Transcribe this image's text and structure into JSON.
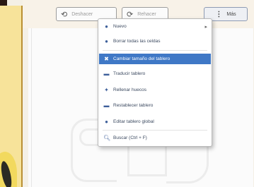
{
  "toolbar": {
    "undo_label": "Deshacer",
    "redo_label": "Rehacer",
    "more_label": "Más"
  },
  "menu": {
    "items": [
      {
        "label": "Nuevo",
        "icon": "plus-circle-icon",
        "has_submenu": true
      },
      {
        "label": "Borrar todas las celdas",
        "icon": "minus-circle-icon"
      },
      {
        "label": "Cambiar tamaño del tablero",
        "icon": "resize-icon",
        "active": true
      },
      {
        "label": "Traducir tablero",
        "icon": "translate-icon"
      },
      {
        "label": "Rellenar huecos",
        "icon": "fill-icon"
      },
      {
        "label": "Restablecer tablero",
        "icon": "refresh-icon"
      },
      {
        "label": "Editar tablero global",
        "icon": "globe-icon"
      },
      {
        "label": "Buscar (Ctrl + F)",
        "icon": "search-icon"
      }
    ]
  },
  "colors": {
    "menu_highlight": "#3f78c6",
    "menu_text": "#3c4a60",
    "background": "#f4f0e6"
  }
}
